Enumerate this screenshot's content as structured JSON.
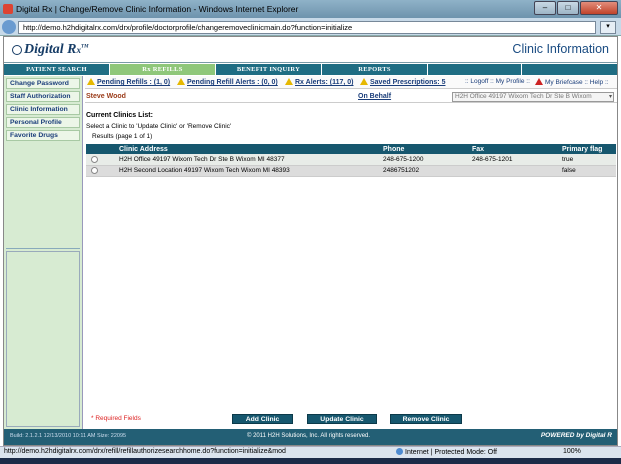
{
  "window": {
    "title": "Digital Rx | Change/Remove Clinic Information - Windows Internet Explorer",
    "min": "–",
    "max": "□",
    "close": "✕"
  },
  "browser": {
    "url": "http://demo.h2hdigitalrx.com/drx/profile/doctorprofile/changeremoveclinicmain.do?function=initialize"
  },
  "app": {
    "logo_text": "Digital R",
    "logo_sub": "x",
    "logo_tm": "TM",
    "page_title": "Clinic Information"
  },
  "tabs": [
    {
      "label": "PATIENT SEARCH"
    },
    {
      "label": "Rx REFILLS"
    },
    {
      "label": "BENEFIT INQUIRY"
    },
    {
      "label": "REPORTS"
    },
    {
      "label": ""
    },
    {
      "label": ""
    }
  ],
  "alerts": {
    "pending_refills": "Pending Refills : (1, 0)",
    "pending_refill_alerts": "Pending Refill Alerts : (0, 0)",
    "rx_alerts": "Rx Alerts: (117, 0)",
    "saved_prescriptions": "Saved Prescriptions: 5",
    "logoff": ":: Logoff :: My Profile ::",
    "briefcase": "My Briefcase :: Help ::"
  },
  "sidebar": {
    "items": [
      {
        "label": "Change Password"
      },
      {
        "label": "Staff Authorization"
      },
      {
        "label": "Clinic Information"
      },
      {
        "label": "Personal Profile"
      },
      {
        "label": "Favorite Drugs"
      }
    ]
  },
  "user": {
    "name": "Steve Wood",
    "on_behalf": "On Behalf",
    "office": "H2H Office 49197 Wixom Tech Dr Ste B Wixom"
  },
  "clinics": {
    "title": "Current Clinics List:",
    "instruction": "Select a Clinic to 'Update Clinic' or 'Remove Clinic'",
    "results": "Results (page 1 of 1)",
    "columns": [
      "Clinic Address",
      "Phone",
      "Fax",
      "Primary flag"
    ],
    "rows": [
      {
        "address": "H2H Office    49197 Wixom Tech Dr  Ste B  Wixom  MI  48377",
        "phone": "248-675-1200",
        "fax": "248-675-1201",
        "primary": "true"
      },
      {
        "address": "H2H Second Location    49197 Wixom Tech    Wixom  MI  48393",
        "phone": "2486751202",
        "fax": "",
        "primary": "false"
      }
    ]
  },
  "footer": {
    "required": "* Required Fields",
    "add": "Add Clinic",
    "update": "Update Clinic",
    "remove": "Remove Clinic",
    "build": "Build: 2.1.2.1 12/13/2010 10:11 AM Size: 22095",
    "copyright": "© 2011 H2H Solutions, Inc. All rights reserved.",
    "powered": "POWERED by Digital R"
  },
  "status": {
    "text": "http://demo.h2hdigitalrx.com/drx/refill/refillauthorizesearchhome.do?function=initialize&mod",
    "zone": "Internet | Protected Mode: Off",
    "zoom": "100%"
  }
}
